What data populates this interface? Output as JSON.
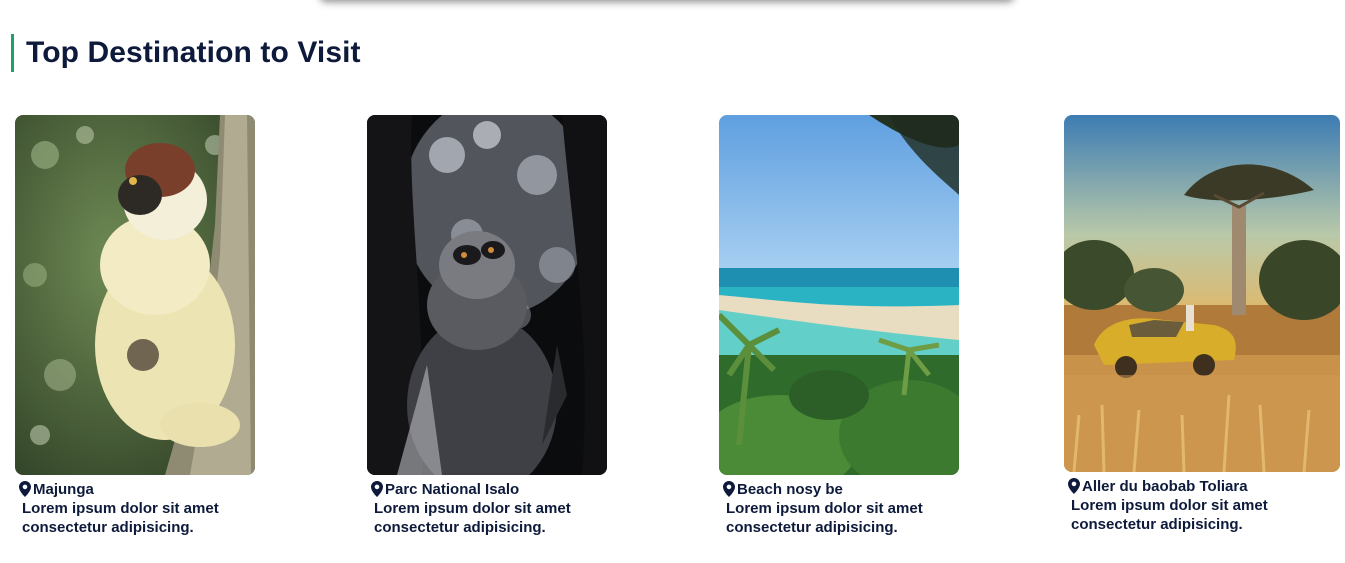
{
  "section": {
    "title": "Top Destination to Visit",
    "accent_color": "#1aa36a",
    "text_color": "#0e1a3b"
  },
  "destinations": [
    {
      "location": "Majunga",
      "description": "Lorem ipsum dolor sit amet\nconsectetur adipisicing.",
      "image": "sifaka-lemur-on-tree-photo"
    },
    {
      "location": "Parc National Isalo",
      "description": "Lorem ipsum dolor sit amet\nconsectetur adipisicing.",
      "image": "ring-tailed-lemur-silhouette-photo"
    },
    {
      "location": "Beach nosy be",
      "description": "Lorem ipsum dolor sit amet\nconsectetur adipisicing.",
      "image": "tropical-beach-lagoon-photo"
    },
    {
      "location": "Aller du baobab Toliara",
      "description": "Lorem ipsum dolor sit amet\nconsectetur adipisicing.",
      "image": "baobab-yellow-car-savanna-photo"
    }
  ],
  "icons": {
    "location": "map-pin-icon"
  }
}
